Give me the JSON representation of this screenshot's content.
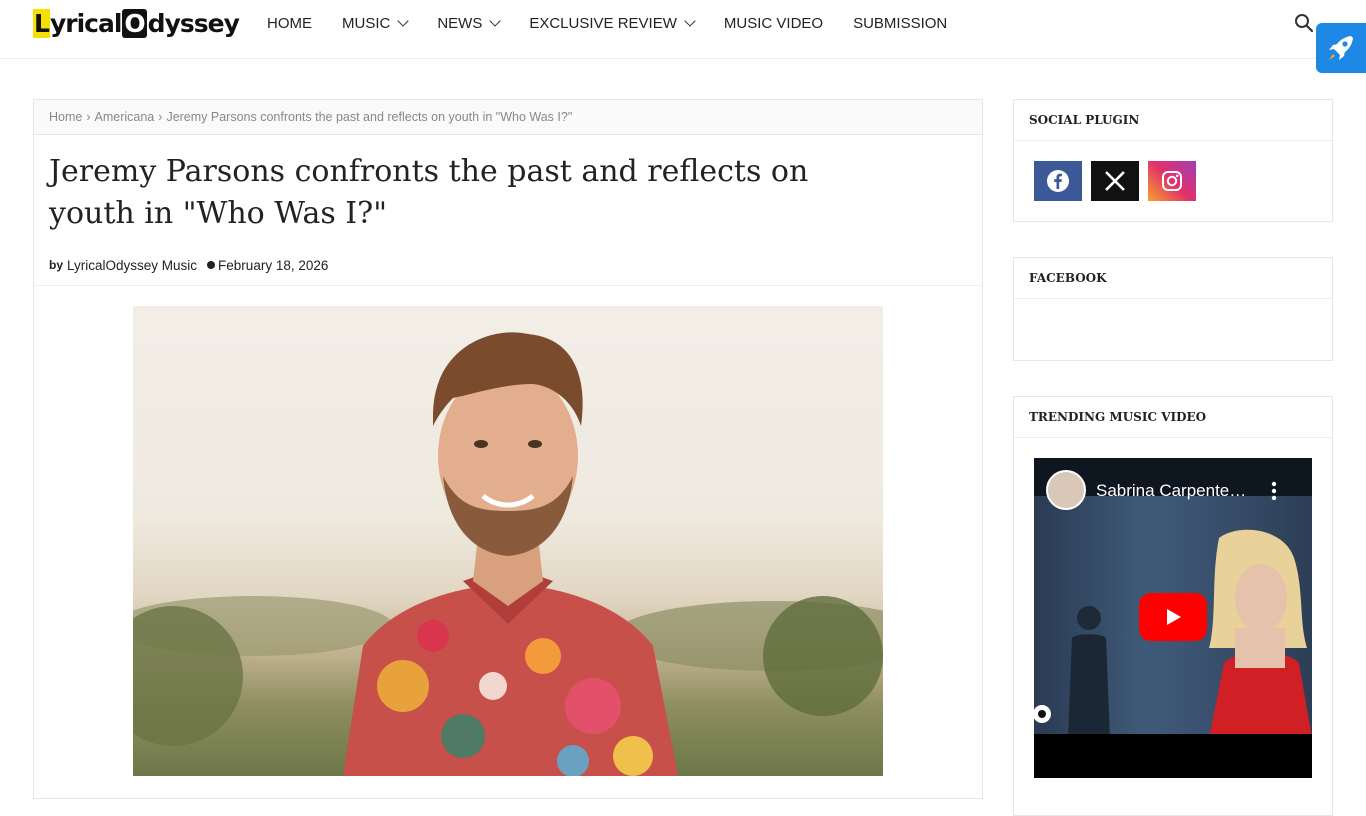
{
  "site": {
    "logo_text_part1": "L",
    "logo_text_part2": "yrical",
    "logo_text_part3": "O",
    "logo_text_part4": "dyssey",
    "brand_color": "#f5e000"
  },
  "nav": {
    "items": [
      {
        "label": "HOME",
        "has_dropdown": false
      },
      {
        "label": "MUSIC",
        "has_dropdown": true
      },
      {
        "label": "NEWS",
        "has_dropdown": true
      },
      {
        "label": "EXCLUSIVE REVIEW",
        "has_dropdown": true
      },
      {
        "label": "MUSIC VIDEO",
        "has_dropdown": false
      },
      {
        "label": "SUBMISSION",
        "has_dropdown": false
      }
    ],
    "search_icon": "search-icon",
    "rocket_icon": "rocket-icon"
  },
  "breadcrumb": {
    "home": "Home",
    "sep1": "›",
    "category": "Americana",
    "sep2": "›",
    "current": "Jeremy Parsons confronts the past and reflects on youth in \"Who Was I?\""
  },
  "post": {
    "title": "Jeremy Parsons confronts the past and reflects on youth in \"Who Was I?\"",
    "by_label": "by",
    "author": "LyricalOdyssey Music",
    "date": "February 18, 2026"
  },
  "sidebar": {
    "social": {
      "title": "SOCIAL PLUGIN",
      "icons": [
        "facebook-icon",
        "x-icon",
        "instagram-icon"
      ]
    },
    "facebook": {
      "title": "FACEBOOK"
    },
    "trending": {
      "title": "TRENDING MUSIC VIDEO",
      "video_title": "Sabrina Carpente…",
      "play_color": "#ff0000"
    }
  }
}
